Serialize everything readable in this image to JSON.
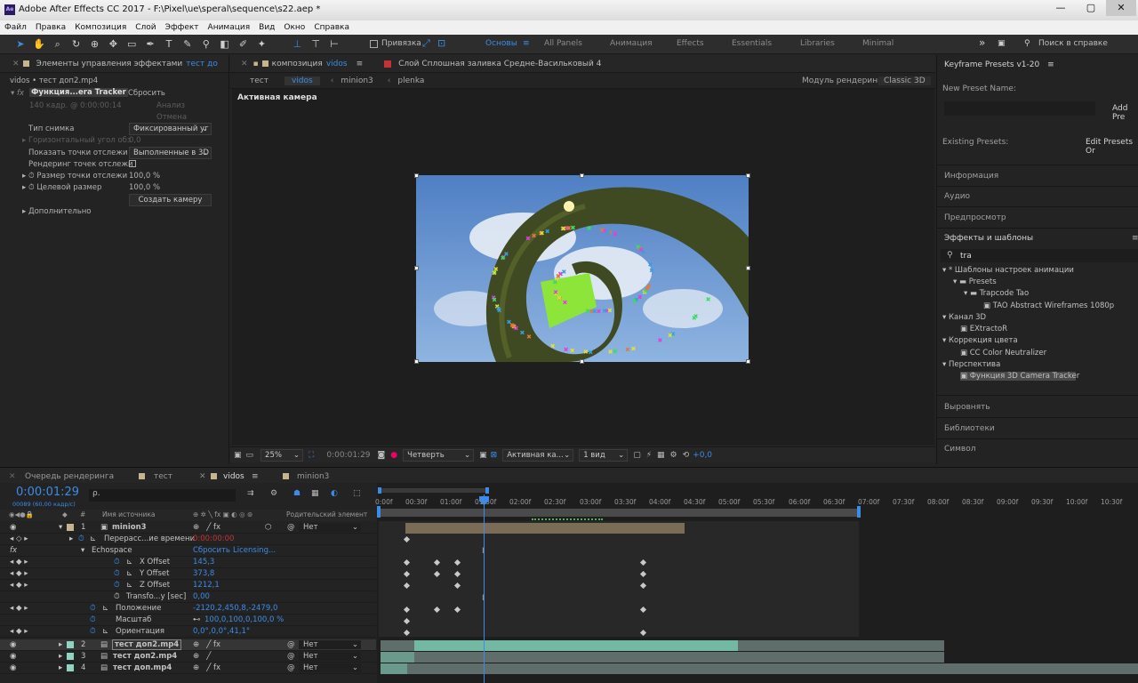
{
  "window": {
    "title": "Adobe After Effects CC 2017 - F:\\Pixel\\ue\\speral\\sequence\\s22.aep *",
    "app_icon": "Ae",
    "min": "—",
    "max": "▢",
    "close": "✕"
  },
  "menu": [
    "Файл",
    "Правка",
    "Композиция",
    "Слой",
    "Эффект",
    "Анимация",
    "Вид",
    "Окно",
    "Справка"
  ],
  "toolbar": {
    "snap_label": "Привязка",
    "workspaces": [
      "Основы",
      "All Panels",
      "Анимация",
      "Effects",
      "Essentials",
      "Libraries",
      "Minimal"
    ],
    "search_placeholder": "Поиск в справке",
    "more": "»"
  },
  "effects_panel": {
    "tab": "Элементы управления эффектами",
    "tab_target": "тест до",
    "breadcrumb": "vidos • тест доп2.mp4",
    "effect_name": "Функция...era Tracker",
    "reset": "Сбросить",
    "analysis_status": "140 кадр. @ 0:00:00:14",
    "analyze_btn": "Анализ",
    "cancel_btn": "Отмена",
    "rows": [
      {
        "label": "Тип снимка",
        "value": "Фиксированный уг"
      },
      {
        "label": "Горизонтальный угол обз",
        "value": "0,0"
      },
      {
        "label": "Показать точки отслежи",
        "value": "Выполненные в 3D"
      },
      {
        "label": "Рендеринг точек отслежи",
        "value": ""
      },
      {
        "label": "Размер точки отслежи",
        "value": "100,0 %"
      },
      {
        "label": "Целевой размер",
        "value": "100,0 %"
      },
      {
        "label": "",
        "value": "Создать камеру"
      },
      {
        "label": "Дополнительно",
        "value": ""
      }
    ]
  },
  "comp_panel": {
    "tab": "композиция",
    "tab_target": "vidos",
    "layer_tab": "Слой Сплошная заливка Средне-Васильковый 4",
    "crumbs": [
      "тест",
      "vidos",
      "minion3",
      "plenka"
    ],
    "renderer_label": "Модуль рендеринга:",
    "renderer": "Classic 3D",
    "camera_label": "Активная камера",
    "footer": {
      "zoom": "25%",
      "time": "0:00:01:29",
      "resolution": "Четверть",
      "view": "Активная ка...",
      "views": "1 вид",
      "exposure": "+0,0"
    }
  },
  "right_panel": {
    "title": "Keyframe Presets v1-20",
    "new_preset": "New Preset Name:",
    "add": "Add Pre",
    "existing": "Existing  Presets:",
    "edit": "Edit Presets Or",
    "sections": [
      "Информация",
      "Аудио",
      "Предпросмотр",
      "Эффекты и шаблоны"
    ],
    "search": "tra",
    "tree": [
      {
        "t": "* Шаблоны настроек анимации",
        "lvl": 0,
        "kind": "folder"
      },
      {
        "t": "Presets",
        "lvl": 1,
        "kind": "folder"
      },
      {
        "t": "Trapcode Tao",
        "lvl": 2,
        "kind": "folder"
      },
      {
        "t": "TAO Abstract Wireframes 1080p",
        "lvl": 3,
        "kind": "fx"
      },
      {
        "t": "Канал 3D",
        "lvl": 0,
        "kind": "cat"
      },
      {
        "t": "EXtractoR",
        "lvl": 1,
        "kind": "fx"
      },
      {
        "t": "Коррекция цвета",
        "lvl": 0,
        "kind": "cat"
      },
      {
        "t": "CC Color Neutralizer",
        "lvl": 1,
        "kind": "fx"
      },
      {
        "t": "Перспектива",
        "lvl": 0,
        "kind": "cat"
      },
      {
        "t": "Функция 3D Camera Tracker",
        "lvl": 1,
        "kind": "fx",
        "selected": true
      }
    ],
    "bottom": [
      "Выровнять",
      "Библиотеки",
      "Символ"
    ]
  },
  "timeline": {
    "tabs": [
      "Очередь рендеринга",
      "тест",
      "vidos",
      "minion3"
    ],
    "timecode": "0:00:01:29",
    "fps": "00089 (60,00 кадр/с)",
    "search_placeholder": "ρ.",
    "col_source": "Имя источника",
    "col_parent": "Родительский элемент",
    "ticks": [
      "0:00f",
      "00:30f",
      "01:00f",
      "01:30f",
      "02:00f",
      "02:30f",
      "03:00f",
      "03:30f",
      "04:00f",
      "04:30f",
      "05:00f",
      "05:30f",
      "06:00f",
      "06:30f",
      "07:00f",
      "07:30f",
      "08:00f",
      "08:30f",
      "09:00f",
      "09:30f",
      "10:00f",
      "10:30f"
    ],
    "layers": [
      {
        "num": "1",
        "name": "minion3",
        "parent": "Нет",
        "kind": "layer"
      },
      {
        "name": "Перерасс...ие времени",
        "value": "0:00:00:00",
        "kind": "prop",
        "red": true
      },
      {
        "name": "Echospace",
        "value": "Сбросить",
        "extra": "Licensing...",
        "kind": "fx"
      },
      {
        "name": "X Offset",
        "value": "145,3",
        "kind": "prop"
      },
      {
        "name": "Y Offset",
        "value": "373,8",
        "kind": "prop"
      },
      {
        "name": "Z Offset",
        "value": "1212,1",
        "kind": "prop"
      },
      {
        "name": "Transfo...y [sec]",
        "value": "0,00",
        "kind": "prop"
      },
      {
        "name": "Положение",
        "value": "-2120,2,450,8,-2479,0",
        "kind": "prop"
      },
      {
        "name": "Масштаб",
        "value": "100,0,100,0,100,0 %",
        "kind": "prop"
      },
      {
        "name": "Ориентация",
        "value": "0,0°,0,0°,41,1°",
        "kind": "prop"
      },
      {
        "num": "2",
        "name": "тест доп2.mp4",
        "parent": "Нет",
        "kind": "layer",
        "selected": true
      },
      {
        "num": "3",
        "name": "тест доп2.mp4",
        "parent": "Нет",
        "kind": "layer"
      },
      {
        "num": "4",
        "name": "тест доп.mp4",
        "parent": "Нет",
        "kind": "layer"
      }
    ]
  },
  "colors": {
    "accent": "#3d8be7",
    "label_tan": "#c7b48f",
    "track_green": "#73b8a3"
  }
}
